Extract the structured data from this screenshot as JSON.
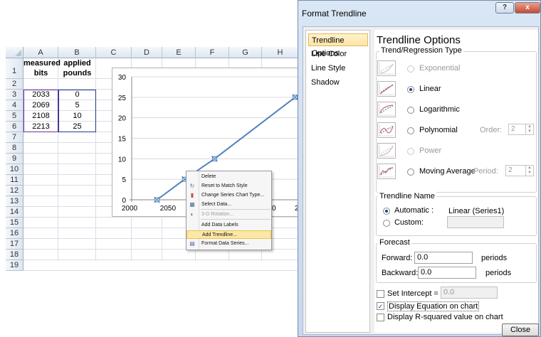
{
  "sheet": {
    "columns": [
      "A",
      "B",
      "C",
      "D",
      "E",
      "F",
      "G",
      "H"
    ],
    "rows": [
      "1",
      "2",
      "3",
      "4",
      "5",
      "6",
      "7",
      "8",
      "9",
      "10",
      "11",
      "12",
      "13",
      "14",
      "15",
      "16",
      "17",
      "18",
      "19"
    ],
    "header_a": [
      "measured",
      "bits"
    ],
    "header_b": [
      "applied",
      "pounds"
    ],
    "data_a": [
      "2033",
      "2069",
      "2108",
      "2213"
    ],
    "data_b": [
      "0",
      "5",
      "10",
      "25"
    ]
  },
  "chart_data": {
    "type": "scatter",
    "x": [
      2033,
      2069,
      2108,
      2213
    ],
    "y": [
      0,
      5,
      10,
      25
    ],
    "xlim": [
      2000,
      2200
    ],
    "ylim": [
      0,
      30
    ],
    "x_ticks": [
      "2000",
      "2050"
    ],
    "y_ticks": [
      "0",
      "5",
      "10",
      "15",
      "20",
      "25",
      "30"
    ],
    "x_tick_fragments": [
      "0",
      "2"
    ],
    "series_color": "#4f81bd",
    "grid": true
  },
  "context_menu": {
    "items": [
      {
        "label": "Delete",
        "icon": "delete-icon",
        "disabled": false
      },
      {
        "label": "Reset to Match Style",
        "icon": "reset-style-icon",
        "disabled": false
      },
      {
        "label": "Change Series Chart Type...",
        "icon": "chart-type-icon",
        "disabled": false
      },
      {
        "label": "Select Data...",
        "icon": "select-data-icon",
        "disabled": false
      },
      {
        "label": "3-D Rotation...",
        "icon": "rotation-icon",
        "disabled": true
      },
      {
        "label": "Add Data Labels",
        "icon": "",
        "disabled": false
      },
      {
        "label": "Add Trendline...",
        "icon": "",
        "disabled": false,
        "highlighted": true
      },
      {
        "label": "Format Data Series...",
        "icon": "format-series-icon",
        "disabled": false
      }
    ]
  },
  "dialog": {
    "title": "Format Trendline",
    "help": "?",
    "close_x": "x",
    "nav": [
      "Trendline Options",
      "Line Color",
      "Line Style",
      "Shadow"
    ],
    "heading": "Trendline Options",
    "trend_group": "Trend/Regression Type",
    "types": [
      "Exponential",
      "Linear",
      "Logarithmic",
      "Polynomial",
      "Power",
      "Moving Average"
    ],
    "order_label": "Order:",
    "order_value": "2",
    "period_label": "Period:",
    "period_value": "2",
    "name_group": "Trendline Name",
    "automatic_label": "Automatic :",
    "automatic_value": "Linear (Series1)",
    "custom_label": "Custom:",
    "forecast_group": "Forecast",
    "forward_label": "Forward:",
    "forward_value": "0.0",
    "backward_label": "Backward:",
    "backward_value": "0.0",
    "periods": "periods",
    "intercept_label": "Set Intercept =",
    "intercept_value": "0.0",
    "display_eq": "Display Equation on chart",
    "display_r2": "Display R-squared value on chart",
    "close_button": "Close"
  }
}
